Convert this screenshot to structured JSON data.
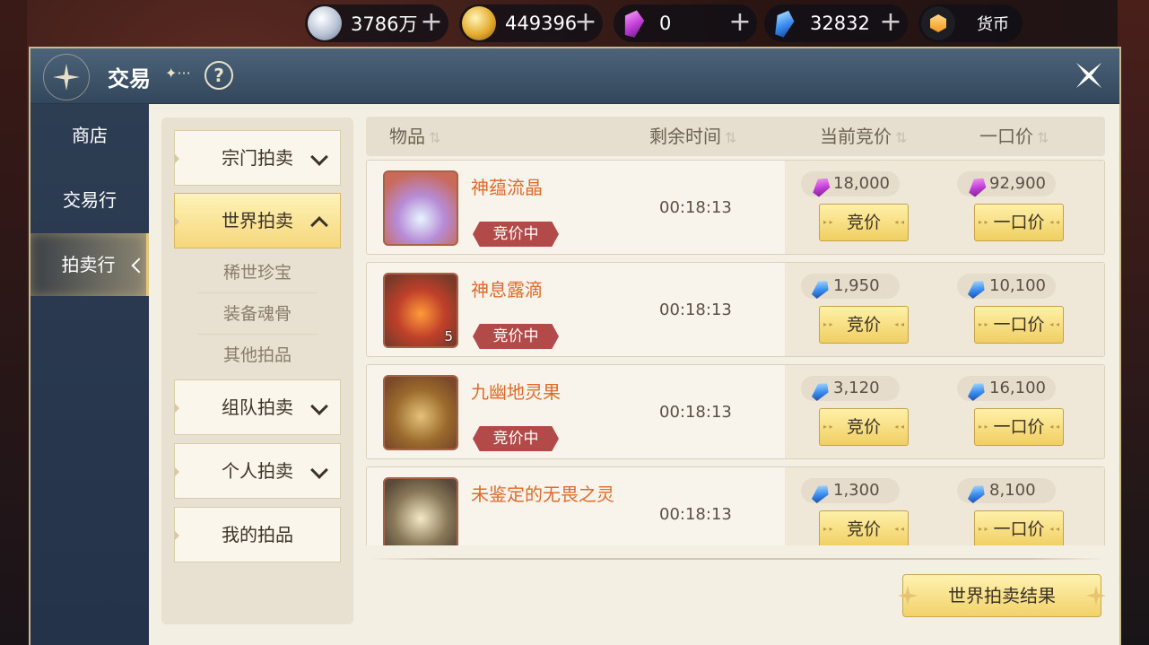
{
  "currencies": [
    {
      "value": "3786万",
      "icon": "silver-coin-icon"
    },
    {
      "value": "449396",
      "icon": "gold-coin-icon"
    },
    {
      "value": "0",
      "icon": "purple-gem-icon"
    },
    {
      "value": "32832",
      "icon": "blue-crystal-icon"
    },
    {
      "value": "货币",
      "icon": "orange-hex-icon"
    }
  ],
  "header": {
    "title": "交易",
    "deco": "✦···",
    "help": "?"
  },
  "nav": {
    "items": [
      {
        "label": "商店"
      },
      {
        "label": "交易行"
      },
      {
        "label": "拍卖行"
      }
    ],
    "active": "拍卖行"
  },
  "categories": {
    "sect": "宗门拍卖",
    "world": "世界拍卖",
    "world_sub": [
      "稀世珍宝",
      "装备魂骨",
      "其他拍品"
    ],
    "team": "组队拍卖",
    "personal": "个人拍卖",
    "mine": "我的拍品"
  },
  "table": {
    "headers": [
      "物品",
      "剩余时间",
      "当前竞价",
      "一口价"
    ],
    "sort_glyph": "⇅"
  },
  "items": [
    {
      "name": "神蕴流晶",
      "status": "竞价中",
      "time": "00:18:13",
      "bid_currency": "purple",
      "bid": "18,000",
      "buyout": "92,900",
      "qty": "",
      "bid_btn": "竞价",
      "buyout_btn": "一口价"
    },
    {
      "name": "神息露滴",
      "status": "竞价中",
      "time": "00:18:13",
      "bid_currency": "blue",
      "bid": "1,950",
      "buyout": "10,100",
      "qty": "5",
      "bid_btn": "竞价",
      "buyout_btn": "一口价"
    },
    {
      "name": "九幽地灵果",
      "status": "竞价中",
      "time": "00:18:13",
      "bid_currency": "blue",
      "bid": "3,120",
      "buyout": "16,100",
      "qty": "",
      "bid_btn": "竞价",
      "buyout_btn": "一口价"
    },
    {
      "name": "未鉴定的无畏之灵",
      "status": "",
      "time": "00:18:13",
      "bid_currency": "blue",
      "bid": "1,300",
      "buyout": "8,100",
      "qty": "",
      "bid_btn": "竞价",
      "buyout_btn": "一口价"
    }
  ],
  "footer": {
    "result_button": "世界拍卖结果"
  },
  "colors": {
    "accent_gold": "#f0cf62",
    "badge_red": "#b24a4a",
    "item_name": "#e06a2a",
    "header_blue": "#3d5269"
  }
}
